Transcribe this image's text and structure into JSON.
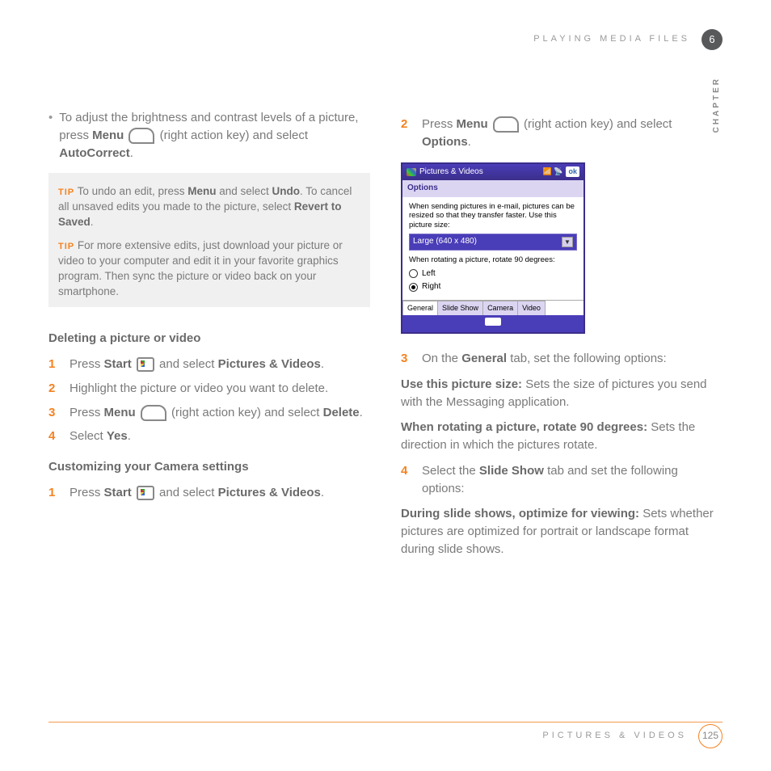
{
  "header": {
    "section": "PLAYING MEDIA FILES",
    "chapter_num": "6",
    "chapter_label": "CHAPTER"
  },
  "left": {
    "bullet": {
      "pre": "To adjust the brightness and contrast levels of a picture, press ",
      "b1": "Menu",
      "mid": " (right action key) and select ",
      "b2": "AutoCorrect",
      "end": "."
    },
    "tip1": {
      "label": "TIP",
      "pre": "To undo an edit, press ",
      "b1": "Menu",
      "mid1": " and select ",
      "b2": "Undo",
      "mid2": ". To cancel all unsaved edits you made to the picture, select ",
      "b3": "Revert to Saved",
      "end": "."
    },
    "tip2": {
      "label": "TIP",
      "text": "For more extensive edits, just download your picture or video to your computer and edit it in your favorite graphics program. Then sync the picture or video back on your smartphone."
    },
    "h1": "Deleting a picture or video",
    "d1": {
      "n": "1",
      "pre": "Press ",
      "b1": "Start",
      "mid": " and select ",
      "b2": "Pictures & Videos",
      "end": "."
    },
    "d2": {
      "n": "2",
      "text": "Highlight the picture or video you want to delete."
    },
    "d3": {
      "n": "3",
      "pre": "Press ",
      "b1": "Menu",
      "mid": " (right action key) and select ",
      "b2": "Delete",
      "end": "."
    },
    "d4": {
      "n": "4",
      "pre": "Select ",
      "b1": "Yes",
      "end": "."
    },
    "h2": "Customizing your Camera settings",
    "c1": {
      "n": "1",
      "pre": "Press ",
      "b1": "Start",
      "mid": " and select ",
      "b2": "Pictures & Videos",
      "end": "."
    }
  },
  "right": {
    "s2": {
      "n": "2",
      "pre": "Press ",
      "b1": "Menu",
      "mid": " (right action key) and select ",
      "b2": "Options",
      "end": "."
    },
    "ss": {
      "title": "Pictures & Videos",
      "ok": "ok",
      "options": "Options",
      "desc": "When sending pictures in e-mail, pictures can be resized so that they transfer faster. Use this picture size:",
      "select": "Large (640 x 480)",
      "rotate": "When rotating a picture, rotate 90 degrees:",
      "left": "Left",
      "right_lbl": "Right",
      "tabs": [
        "General",
        "Slide Show",
        "Camera",
        "Video"
      ]
    },
    "s3": {
      "n": "3",
      "pre": "On the ",
      "b1": "General",
      "post": " tab, set the following options:"
    },
    "p1": {
      "b": "Use this picture size:",
      "t": " Sets the size of pictures you send with the Messaging application."
    },
    "p2": {
      "b": "When rotating a picture, rotate 90 degrees:",
      "t": " Sets the direction in which the pictures rotate."
    },
    "s4": {
      "n": "4",
      "pre": "Select the ",
      "b1": "Slide Show",
      "post": " tab and set the following options:"
    },
    "p3": {
      "b": "During slide shows, optimize for viewing:",
      "t": " Sets whether pictures are optimized for portrait or landscape format during slide shows."
    }
  },
  "footer": {
    "section": "PICTURES & VIDEOS",
    "page": "125"
  }
}
